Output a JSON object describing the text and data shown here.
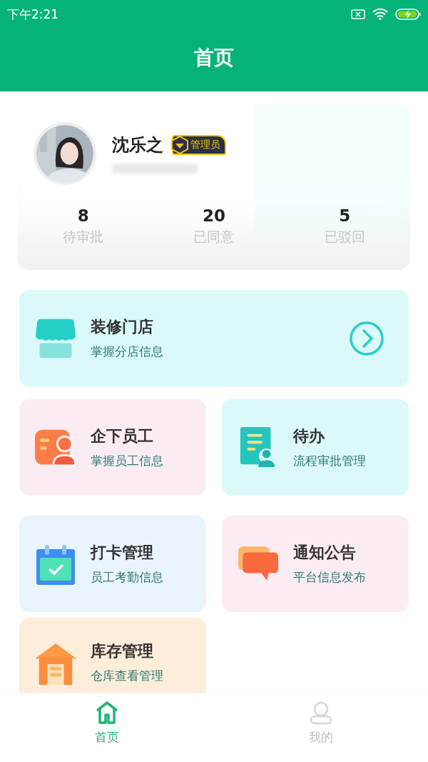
{
  "status_bar": {
    "time": "下午2:21"
  },
  "header": {
    "title": "首页"
  },
  "profile": {
    "name": "沈乐之",
    "role_badge": "管理员",
    "stats": [
      {
        "value": "8",
        "label": "待审批"
      },
      {
        "value": "20",
        "label": "已同意"
      },
      {
        "value": "5",
        "label": "已驳回"
      }
    ]
  },
  "menu_cards": [
    {
      "kind": "wide",
      "title": "装修门店",
      "subtitle": "掌握分店信息"
    },
    {
      "kind": "half",
      "title": "企下员工",
      "subtitle": "掌握员工信息"
    },
    {
      "kind": "half",
      "title": "待办",
      "subtitle": "流程审批管理"
    },
    {
      "kind": "half",
      "title": "打卡管理",
      "subtitle": "员工考勤信息"
    },
    {
      "kind": "half",
      "title": "通知公告",
      "subtitle": "平台信息发布"
    },
    {
      "kind": "half",
      "title": "库存管理",
      "subtitle": "仓库查看管理"
    }
  ],
  "tab_bar": [
    {
      "label": "首页",
      "selected": true
    },
    {
      "label": "我的",
      "selected": false
    }
  ]
}
